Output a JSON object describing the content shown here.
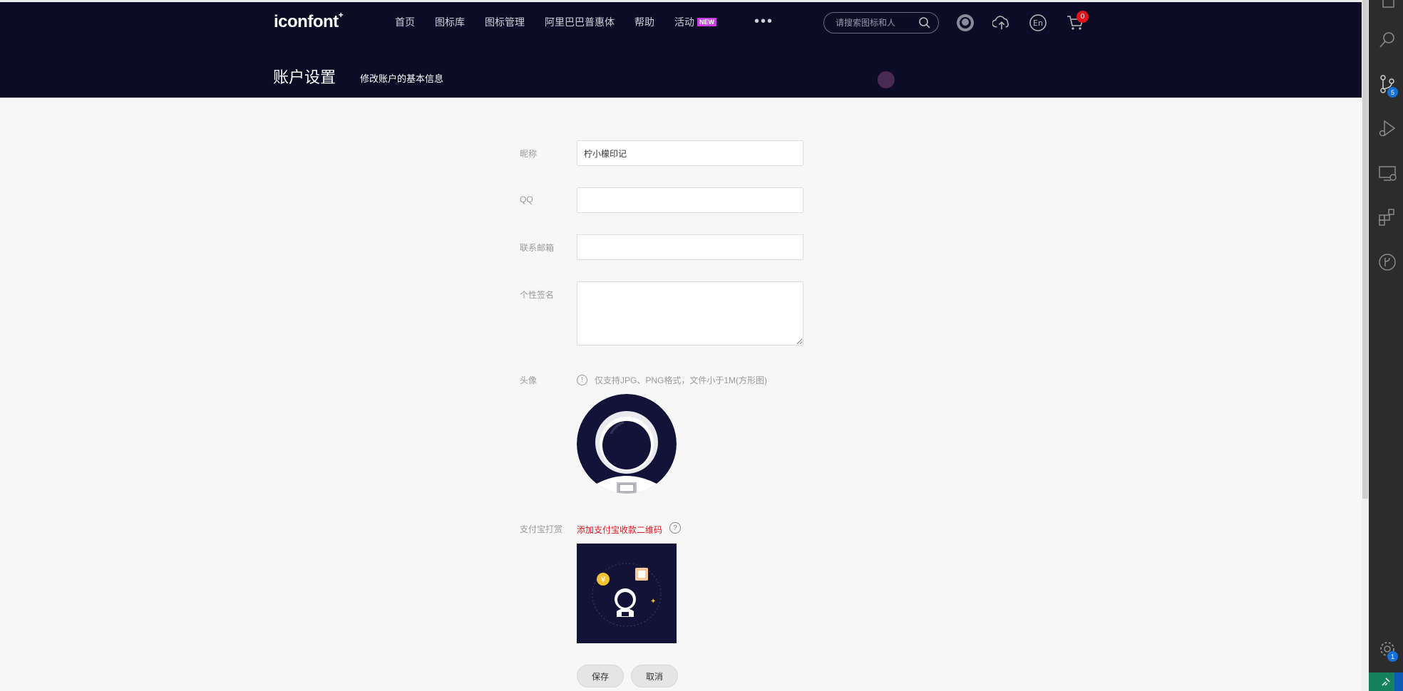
{
  "header": {
    "logo": "iconfont",
    "logo_mark": "+",
    "nav": [
      "首页",
      "图标库",
      "图标管理",
      "阿里巴巴普惠体",
      "帮助",
      "活动"
    ],
    "new_badge": "NEW",
    "more": "•••",
    "search_placeholder": "请搜索图标和人",
    "cart_count": "0",
    "lang_label": "En",
    "page_title": "账户设置",
    "page_subtitle": "修改账户的基本信息"
  },
  "form": {
    "nickname_label": "昵称",
    "nickname_value": "柠小檬印记",
    "qq_label": "QQ",
    "qq_value": "",
    "email_label": "联系邮箱",
    "email_value": "",
    "signature_label": "个性签名",
    "signature_value": "",
    "avatar_label": "头像",
    "avatar_hint": "仅支持JPG、PNG格式，文件小于1M(方形图)",
    "hint_icon": "!",
    "alipay_label": "支付宝打赏",
    "alipay_link": "添加支付宝收款二维码",
    "alipay_help": "?",
    "save_label": "保存",
    "cancel_label": "取消"
  },
  "activity_bar": {
    "source_control_badge": "5",
    "settings_badge": "1"
  },
  "colors": {
    "header_bg": "#0d0c27",
    "accent_red": "#e0151c",
    "new_badge": "#c441e8",
    "vscode_badge": "#1570d8"
  }
}
